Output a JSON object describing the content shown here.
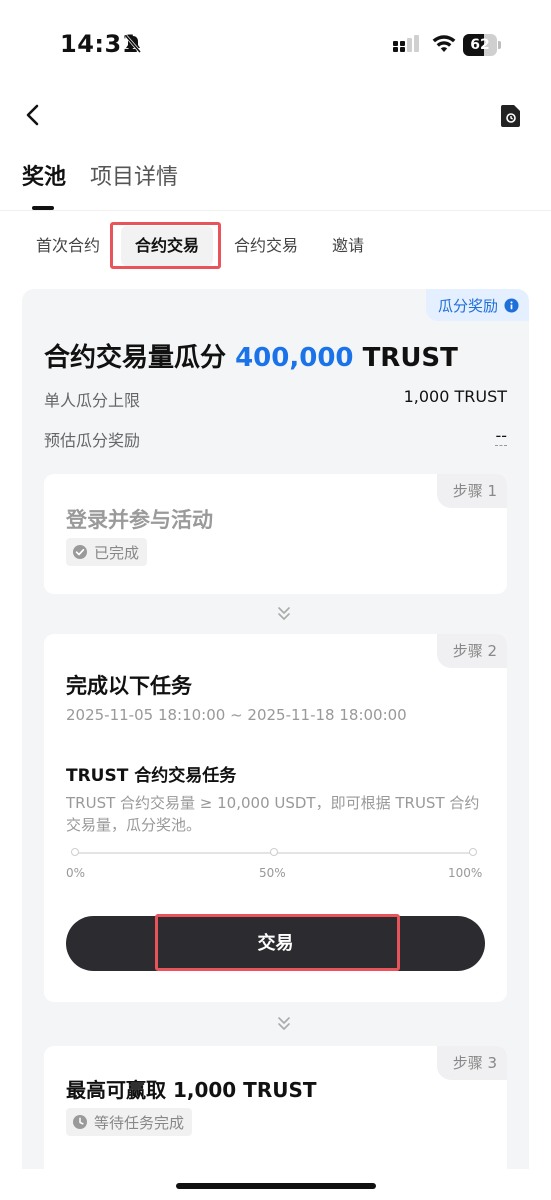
{
  "status_bar": {
    "time": "14:31",
    "battery_level": "62",
    "battery_fraction": 0.62
  },
  "main_tabs": [
    {
      "label": "奖池",
      "active": true
    },
    {
      "label": "项目详情",
      "active": false
    }
  ],
  "sub_tabs": [
    {
      "label": "首次合约",
      "selected": false
    },
    {
      "label": "合约交易",
      "selected": true
    },
    {
      "label": "合约交易",
      "selected": false
    },
    {
      "label": "邀请",
      "selected": false
    }
  ],
  "pool": {
    "badge_label": "瓜分奖励",
    "title_prefix": "合约交易量瓜分",
    "title_amount": "400,000",
    "title_token": "TRUST",
    "max_per_user_label": "单人瓜分上限",
    "max_per_user_value": "1,000 TRUST",
    "estimated_label": "预估瓜分奖励",
    "estimated_value": "--"
  },
  "steps": [
    {
      "tag": "步骤 1",
      "title": "登录并参与活动",
      "status": "已完成"
    },
    {
      "tag": "步骤 2",
      "title": "完成以下任务",
      "date_range": "2025-11-05 18:10:00 ~ 2025-11-18 18:00:00",
      "task_title": "TRUST 合约交易任务",
      "task_desc": "TRUST 合约交易量 ≥ 10,000 USDT，即可根据 TRUST 合约交易量，瓜分奖池。",
      "progress": 0,
      "progress_labels": [
        "0%",
        "50%",
        "100%"
      ],
      "button_label": "交易"
    },
    {
      "tag": "步骤 3",
      "title": "最高可赢取 1,000 TRUST",
      "status": "等待任务完成"
    }
  ],
  "colors": {
    "accent_blue": "#1a73e8",
    "highlight_red": "#e9545a",
    "button_dark": "#2c2c30"
  }
}
